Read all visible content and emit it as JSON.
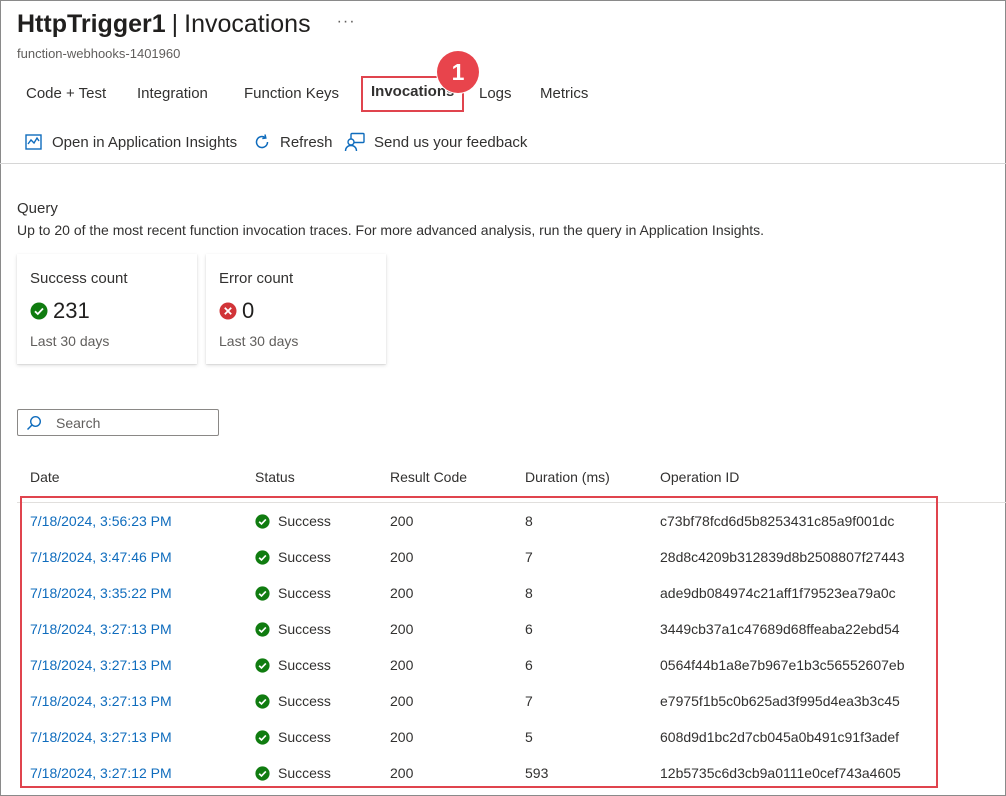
{
  "header": {
    "title": "HttpTrigger1",
    "separator": "|",
    "section": "Invocations",
    "more": "···",
    "subtitle": "function-webhooks-1401960"
  },
  "tabs": [
    "Code + Test",
    "Integration",
    "Function Keys",
    "Invocations",
    "Logs",
    "Metrics"
  ],
  "active_tab": "Invocations",
  "step_badge": "1",
  "toolbar": {
    "app_insights": "Open in Application Insights",
    "refresh": "Refresh",
    "feedback": "Send us your feedback"
  },
  "query": {
    "title": "Query",
    "description": "Up to 20 of the most recent function invocation traces. For more advanced analysis, run the query in Application Insights."
  },
  "cards": {
    "success": {
      "title": "Success count",
      "value": "231",
      "footer": "Last 30 days",
      "icon": "success-check-icon"
    },
    "error": {
      "title": "Error count",
      "value": "0",
      "footer": "Last 30 days",
      "icon": "error-x-icon"
    }
  },
  "search": {
    "placeholder": "Search"
  },
  "table": {
    "headers": [
      "Date",
      "Status",
      "Result Code",
      "Duration (ms)",
      "Operation ID"
    ],
    "rows": [
      {
        "date": "7/18/2024, 3:56:23 PM",
        "status": "Success",
        "code": "200",
        "duration": "8",
        "op_id": "c73bf78fcd6d5b8253431c85a9f001dc"
      },
      {
        "date": "7/18/2024, 3:47:46 PM",
        "status": "Success",
        "code": "200",
        "duration": "7",
        "op_id": "28d8c4209b312839d8b2508807f27443"
      },
      {
        "date": "7/18/2024, 3:35:22 PM",
        "status": "Success",
        "code": "200",
        "duration": "8",
        "op_id": "ade9db084974c21aff1f79523ea79a0c"
      },
      {
        "date": "7/18/2024, 3:27:13 PM",
        "status": "Success",
        "code": "200",
        "duration": "6",
        "op_id": "3449cb37a1c47689d68ffeaba22ebd54"
      },
      {
        "date": "7/18/2024, 3:27:13 PM",
        "status": "Success",
        "code": "200",
        "duration": "6",
        "op_id": "0564f44b1a8e7b967e1b3c56552607eb"
      },
      {
        "date": "7/18/2024, 3:27:13 PM",
        "status": "Success",
        "code": "200",
        "duration": "7",
        "op_id": "e7975f1b5c0b625ad3f995d4ea3b3c45"
      },
      {
        "date": "7/18/2024, 3:27:13 PM",
        "status": "Success",
        "code": "200",
        "duration": "5",
        "op_id": "608d9d1bc2d7cb045a0b491c91f3adef"
      },
      {
        "date": "7/18/2024, 3:27:12 PM",
        "status": "Success",
        "code": "200",
        "duration": "593",
        "op_id": "12b5735c6d3cb9a0111e0cef743a4605"
      }
    ]
  },
  "colors": {
    "link": "#0f6cbd",
    "success": "#107c10",
    "error": "#d13438",
    "highlight": "#e0444e"
  }
}
